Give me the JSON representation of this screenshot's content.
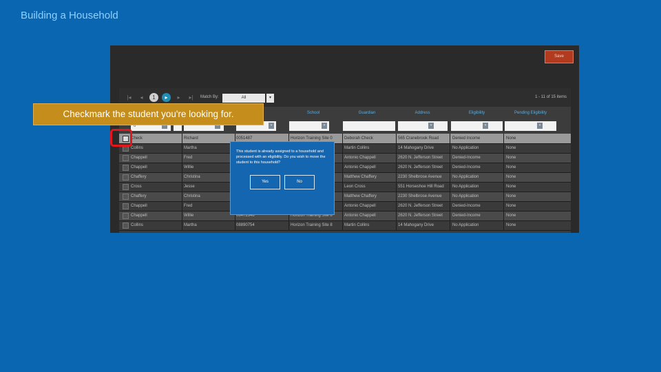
{
  "slide_title": "Building a Household",
  "callout_text": "Checkmark the student you're looking for.",
  "toolbar": {
    "save_label": "Save"
  },
  "pager": {
    "first": "|◂",
    "prev": "◂",
    "current_page": "1",
    "next": "▸",
    "next2": "▸",
    "last": "▸|",
    "match_by_label": "Match By:",
    "match_by_value": "All",
    "items_count": "1 - 11 of 15 items"
  },
  "columns": [
    "School",
    "Guardian",
    "Address",
    "Eligibility",
    "Pending Eligibility"
  ],
  "filter_first_value": "0",
  "rows": [
    {
      "last": "Check",
      "first": "Richard",
      "id": "0051487",
      "school": "Horizon Training Site 0",
      "guardian": "Deborah Check",
      "address": "565 Cranebrook Road",
      "elig": "Denied Income",
      "pending": "None"
    },
    {
      "last": "Collins",
      "first": "Martha",
      "id": "",
      "school": "",
      "guardian": "Martin Collins",
      "address": "14 Mahogany Drive",
      "elig": "No Application",
      "pending": "None"
    },
    {
      "last": "Chappell",
      "first": "Fred",
      "id": "",
      "school": "",
      "guardian": "Antonio Chappell",
      "address": "2620 N. Jefferson Street",
      "elig": "Denied-Income",
      "pending": "None"
    },
    {
      "last": "Chappell",
      "first": "Willie",
      "id": "",
      "school": "",
      "guardian": "Antonio Chappell",
      "address": "2620 N. Jefferson Street",
      "elig": "Denied-Income",
      "pending": "None"
    },
    {
      "last": "Chaffery",
      "first": "Christina",
      "id": "",
      "school": "",
      "guardian": "Matthew Chaffery",
      "address": "2230 Shelbrose Avenue",
      "elig": "No Application",
      "pending": "None"
    },
    {
      "last": "Cross",
      "first": "Jesse",
      "id": "",
      "school": "",
      "guardian": "Leon Cross",
      "address": "551 Horseshoe Hill Road",
      "elig": "No Application",
      "pending": "None"
    },
    {
      "last": "Chaffery",
      "first": "Christina",
      "id": "",
      "school": "",
      "guardian": "Matthew Chaffery",
      "address": "2230 Shelbrose Avenue",
      "elig": "No Application",
      "pending": "None"
    },
    {
      "last": "Chappell",
      "first": "Fred",
      "id": "",
      "school": "",
      "guardian": "Antonio Chappell",
      "address": "2620 N. Jefferson Street",
      "elig": "Denied-Income",
      "pending": "None"
    },
    {
      "last": "Chappell",
      "first": "Willie",
      "id": "08472346",
      "school": "Horizon Training Site 8",
      "guardian": "Antonio Chappell",
      "address": "2620 N. Jefferson Street",
      "elig": "Denied-Income",
      "pending": "None"
    },
    {
      "last": "Collins",
      "first": "Martha",
      "id": "08890754",
      "school": "Horizon Training Site 8",
      "guardian": "Martin Collins",
      "address": "14 Mahogany Drive",
      "elig": "No Application",
      "pending": "None"
    }
  ],
  "dialog": {
    "message": "This student is already assigned to a household and processed with an eligibility. Do you wish to move the student to this household?",
    "yes_label": "Yes",
    "no_label": "No"
  }
}
